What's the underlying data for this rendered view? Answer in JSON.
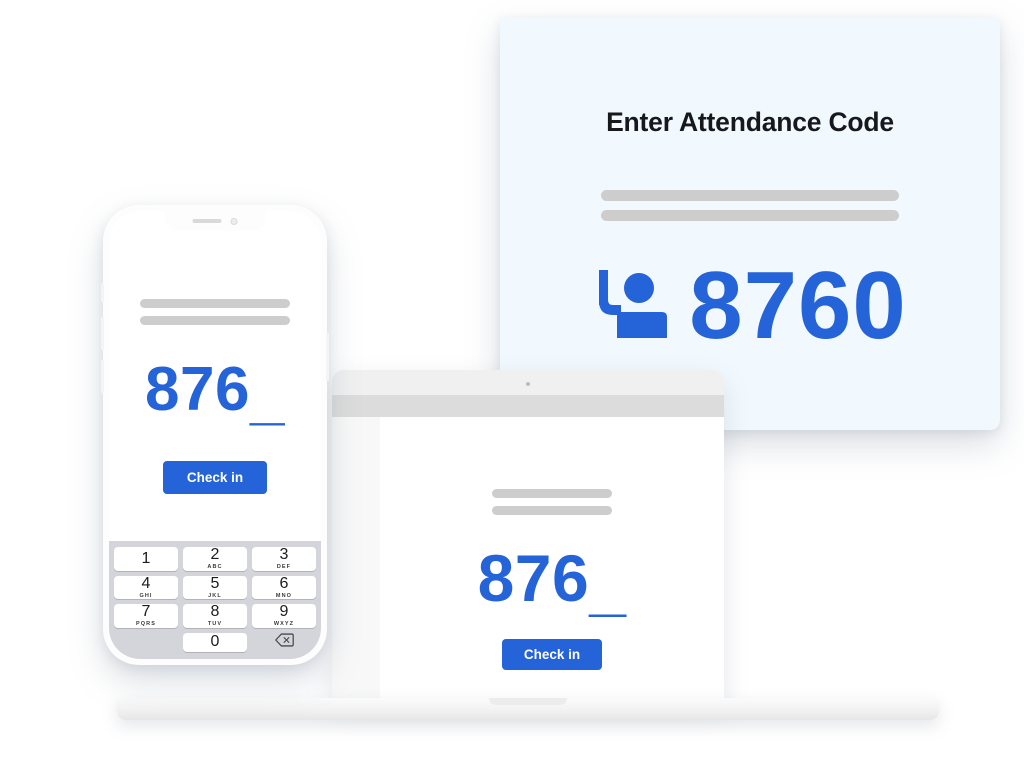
{
  "meta": {
    "accent_blue": "#2563d9",
    "card_bg": "#f1f9fe",
    "placeholder_gray": "#cdcdcd"
  },
  "tv_display": {
    "title": "Enter Attendance Code",
    "icon": "raised-hand-person-icon",
    "code": "8760",
    "placeholder_bars": 2
  },
  "phone": {
    "code": "876",
    "caret": "_",
    "checkin_label": "Check in",
    "placeholder_bars": 2,
    "keypad": {
      "keys": [
        {
          "num": "1",
          "letters": ""
        },
        {
          "num": "2",
          "letters": "ABC"
        },
        {
          "num": "3",
          "letters": "DEF"
        },
        {
          "num": "4",
          "letters": "GHI"
        },
        {
          "num": "5",
          "letters": "JKL"
        },
        {
          "num": "6",
          "letters": "MNO"
        },
        {
          "num": "7",
          "letters": "PQRS"
        },
        {
          "num": "8",
          "letters": "TUV"
        },
        {
          "num": "9",
          "letters": "WXYZ"
        },
        {
          "num": "0",
          "letters": ""
        }
      ],
      "backspace_icon": "backspace-icon"
    }
  },
  "laptop": {
    "code": "876",
    "caret": "_",
    "checkin_label": "Check in",
    "placeholder_bars": 2
  }
}
